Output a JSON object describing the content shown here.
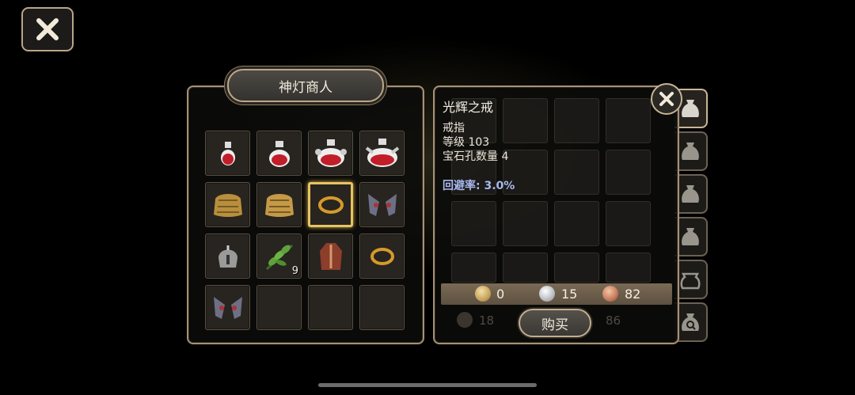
{
  "merchant": {
    "title": "神灯商人",
    "items": [
      {
        "icon": "small-red-potion-icon",
        "count": ""
      },
      {
        "icon": "medium-red-potion-icon",
        "count": ""
      },
      {
        "icon": "large-red-potion-icon",
        "count": ""
      },
      {
        "icon": "huge-red-potion-icon",
        "count": ""
      },
      {
        "icon": "gold-armor-icon",
        "count": ""
      },
      {
        "icon": "gold-armor-alt-icon",
        "count": ""
      },
      {
        "icon": "ring-icon",
        "count": "",
        "selected": true
      },
      {
        "icon": "spiked-gauntlets-icon",
        "count": ""
      },
      {
        "icon": "steel-helmet-icon",
        "count": ""
      },
      {
        "icon": "herb-leaf-icon",
        "count": "9"
      },
      {
        "icon": "leather-robe-icon",
        "count": ""
      },
      {
        "icon": "gold-ring-icon",
        "count": ""
      },
      {
        "icon": "spiked-gauntlets-icon",
        "count": ""
      },
      {
        "icon": "",
        "count": ""
      },
      {
        "icon": "",
        "count": ""
      },
      {
        "icon": "",
        "count": ""
      }
    ]
  },
  "detail": {
    "name": "光辉之戒",
    "type": "戒指",
    "level": "等级 103",
    "gem_slots": "宝石孔数量 4",
    "stat": "回避率: 3.0%",
    "price": {
      "gold": "0",
      "silver": "15",
      "copper": "82"
    },
    "buy_label": "购买"
  },
  "background_inventory": {
    "gold": "18",
    "copper": "86"
  },
  "colors": {
    "accent_gold": "#e7c462",
    "stat_blue": "#a9b8ef",
    "border": "#a69276"
  }
}
